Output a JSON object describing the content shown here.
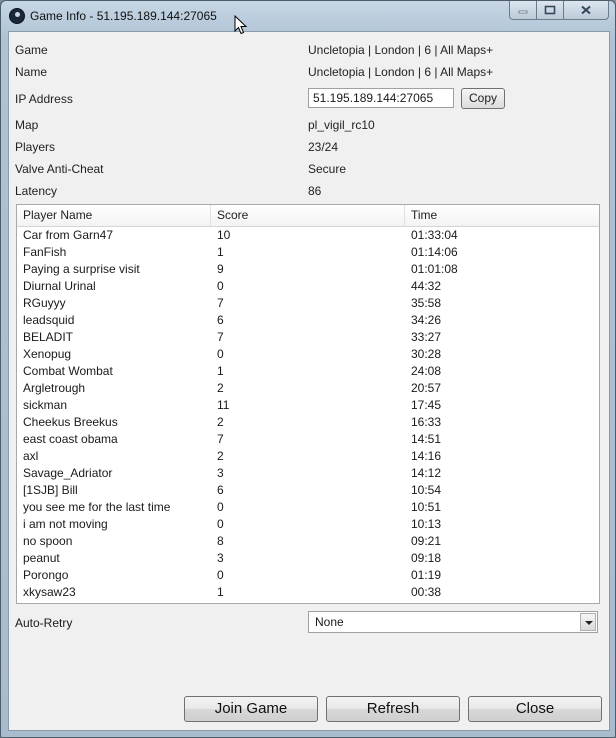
{
  "window": {
    "title": "Game Info - 51.195.189.144:27065",
    "controls": [
      "minimize-icon",
      "maximize-icon",
      "close-icon"
    ]
  },
  "info": {
    "game_label": "Game",
    "game_value": "Uncletopia | London | 6 | All Maps+",
    "name_label": "Name",
    "name_value": "Uncletopia | London | 6 | All Maps+",
    "ip_label": "IP Address",
    "ip_value": "51.195.189.144:27065",
    "copy_label": "Copy",
    "map_label": "Map",
    "map_value": "pl_vigil_rc10",
    "players_label": "Players",
    "players_value": "23/24",
    "vac_label": "Valve Anti-Cheat",
    "vac_value": "Secure",
    "latency_label": "Latency",
    "latency_value": "86"
  },
  "players_table": {
    "columns": [
      "Player Name",
      "Score",
      "Time"
    ],
    "rows": [
      [
        "Car from Garn47",
        "10",
        "01:33:04"
      ],
      [
        "FanFish",
        "1",
        "01:14:06"
      ],
      [
        "Paying a surprise visit",
        "9",
        "01:01:08"
      ],
      [
        "Diurnal Urinal",
        "0",
        "44:32"
      ],
      [
        "RGuyyy",
        "7",
        "35:58"
      ],
      [
        "leadsquid",
        "6",
        "34:26"
      ],
      [
        "BELADIT",
        "7",
        "33:27"
      ],
      [
        "Xenopug",
        "0",
        "30:28"
      ],
      [
        "Combat Wombat",
        "1",
        "24:08"
      ],
      [
        "Argletrough",
        "2",
        "20:57"
      ],
      [
        "sickman",
        "11",
        "17:45"
      ],
      [
        "Cheekus Breekus",
        "2",
        "16:33"
      ],
      [
        "east coast obama",
        "7",
        "14:51"
      ],
      [
        "axl",
        "2",
        "14:16"
      ],
      [
        "Savage_Adriator",
        "3",
        "14:12"
      ],
      [
        "[1SJB] Bill",
        "6",
        "10:54"
      ],
      [
        "you see me for the last time",
        "0",
        "10:51"
      ],
      [
        "i am not moving",
        "0",
        "10:13"
      ],
      [
        "no spoon",
        "8",
        "09:21"
      ],
      [
        "peanut",
        "3",
        "09:18"
      ],
      [
        "Porongo",
        "0",
        "01:19"
      ],
      [
        "xkysaw23",
        "1",
        "00:38"
      ]
    ]
  },
  "auto_retry": {
    "label": "Auto-Retry",
    "selected": "None"
  },
  "buttons": {
    "join": "Join Game",
    "refresh": "Refresh",
    "close": "Close"
  }
}
